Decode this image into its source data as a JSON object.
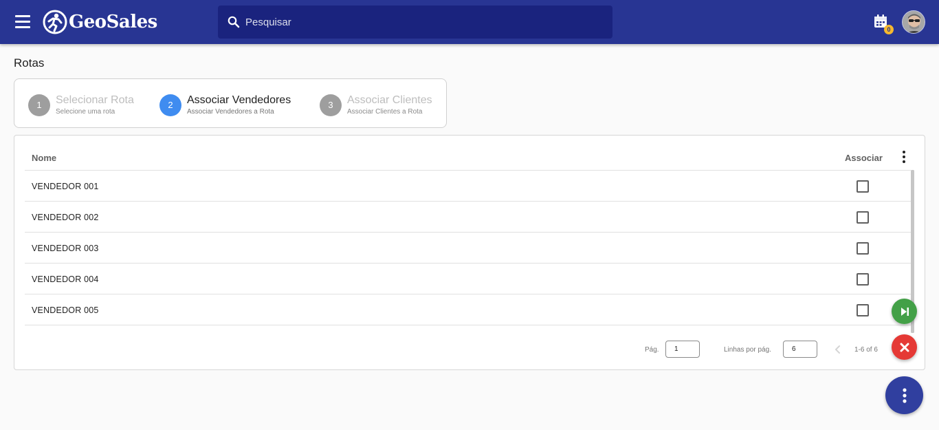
{
  "header": {
    "app_name": "GeoSales",
    "search_placeholder": "Pesquisar",
    "notification_count": "0",
    "icons": [
      "menu-icon",
      "logo-icon",
      "search-icon",
      "calendar-icon",
      "avatar"
    ]
  },
  "page": {
    "title": "Rotas"
  },
  "stepper": {
    "steps": [
      {
        "number": "1",
        "title": "Selecionar Rota",
        "subtitle": "Selecione uma rota",
        "state": "done"
      },
      {
        "number": "2",
        "title": "Associar Vendedores",
        "subtitle": "Associar Vendedores a Rota",
        "state": "active"
      },
      {
        "number": "3",
        "title": "Associar Clientes",
        "subtitle": "Associar Clientes a Rota",
        "state": "pending"
      }
    ]
  },
  "table": {
    "columns": {
      "name": "Nome",
      "associate": "Associar"
    },
    "rows": [
      {
        "name": "VENDEDOR 001",
        "checked": false
      },
      {
        "name": "VENDEDOR 002",
        "checked": false
      },
      {
        "name": "VENDEDOR 003",
        "checked": false
      },
      {
        "name": "VENDEDOR 004",
        "checked": false
      },
      {
        "name": "VENDEDOR 005",
        "checked": false
      }
    ],
    "pagination": {
      "page_label": "Pág.",
      "page_value": "1",
      "rows_label": "Linhas por pág.",
      "rows_value": "6",
      "range": "1-6 of 6"
    }
  },
  "colors": {
    "header": "#283593",
    "search": "#1a237e",
    "active_step": "#3f8cf0",
    "fab_next": "#43a047",
    "fab_cancel": "#e53935",
    "fab_more": "#303f9f"
  }
}
